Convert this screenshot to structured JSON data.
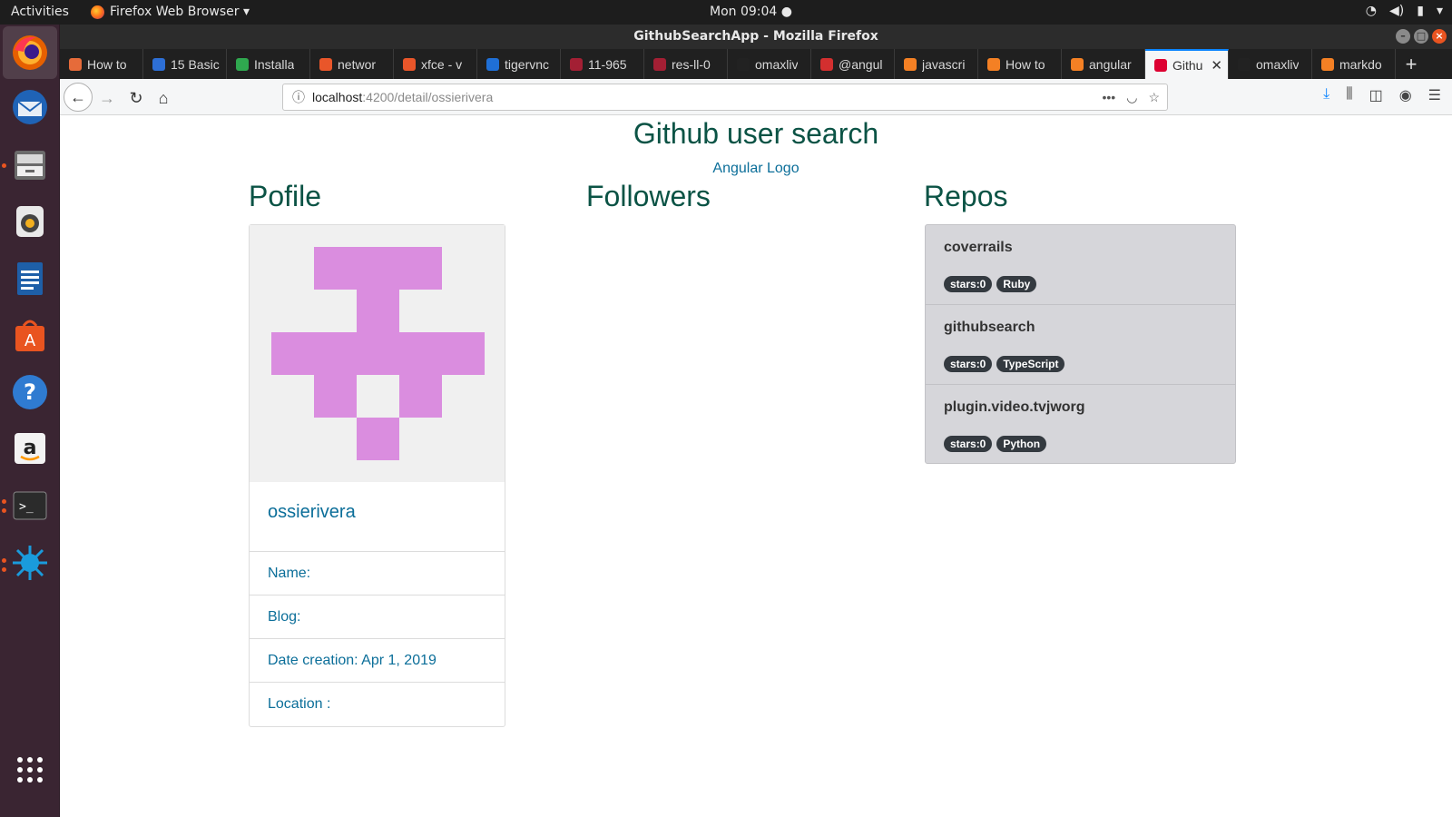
{
  "system": {
    "activities": "Activities",
    "app_menu": "Firefox Web Browser ▾",
    "clock": "Mon 09:04 ●"
  },
  "window": {
    "title": "GithubSearchApp - Mozilla Firefox"
  },
  "tabs": [
    {
      "label": "How to",
      "color": "#e66b3a"
    },
    {
      "label": "15 Basic",
      "color": "#2d6fd6"
    },
    {
      "label": "Installa",
      "color": "#2fa84f"
    },
    {
      "label": "networ",
      "color": "#e9562a"
    },
    {
      "label": "xfce - v",
      "color": "#e9562a"
    },
    {
      "label": "tigervnc",
      "color": "#1f6fd6"
    },
    {
      "label": "11-965",
      "color": "#a31f34"
    },
    {
      "label": "res-ll-0",
      "color": "#a31f34"
    },
    {
      "label": "omaxliv",
      "color": "#222222"
    },
    {
      "label": "@angul",
      "color": "#d32f2f"
    },
    {
      "label": "javascri",
      "color": "#f48024"
    },
    {
      "label": "How to",
      "color": "#f48024"
    },
    {
      "label": "angular",
      "color": "#f48024"
    },
    {
      "label": "Githu",
      "color": "#dd0031",
      "active": true
    },
    {
      "label": "omaxliv",
      "color": "#222222"
    },
    {
      "label": "markdo",
      "color": "#f48024"
    }
  ],
  "urlbar": {
    "host": "localhost",
    "rest": ":4200/detail/ossierivera"
  },
  "page": {
    "title": "Github user search",
    "logo_alt": "Angular Logo",
    "profile_heading": "Pofile",
    "followers_heading": "Followers",
    "repos_heading": "Repos",
    "profile": {
      "username": "ossierivera",
      "name_label": "Name:",
      "blog_label": "Blog:",
      "date_label": "Date creation: Apr 1, 2019",
      "location_label": "Location :",
      "avatar_color": "#da8ddf"
    },
    "repos": [
      {
        "name": "coverrails",
        "stars": "stars:0",
        "language": "Ruby"
      },
      {
        "name": "githubsearch",
        "stars": "stars:0",
        "language": "TypeScript"
      },
      {
        "name": "plugin.video.tvjworg",
        "stars": "stars:0",
        "language": "Python"
      }
    ]
  }
}
